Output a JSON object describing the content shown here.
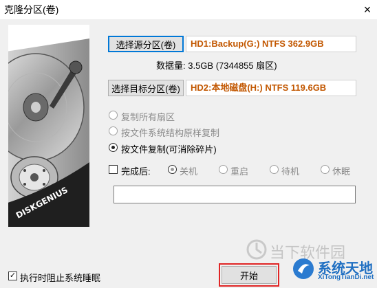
{
  "window": {
    "title": "克隆分区(卷)",
    "close_glyph": "×"
  },
  "disk_image": {
    "brand_text": "DISKGENIUS"
  },
  "source": {
    "button_label": "选择源分区(卷)",
    "value": "HD1:Backup(G:) NTFS 362.9GB"
  },
  "data_amount": {
    "text": "数据量: 3.5GB (7344855 扇区)"
  },
  "target": {
    "button_label": "选择目标分区(卷)",
    "value": "HD2:本地磁盘(H:) NTFS 119.6GB"
  },
  "copy_modes": [
    {
      "label": "复制所有扇区",
      "checked": false,
      "enabled": false
    },
    {
      "label": "按文件系统结构原样复制",
      "checked": false,
      "enabled": false
    },
    {
      "label": "按文件复制(可消除碎片)",
      "checked": true,
      "enabled": true
    }
  ],
  "after_complete": {
    "label": "完成后:",
    "checked": false,
    "options": [
      {
        "label": "关机",
        "checked": true
      },
      {
        "label": "重启",
        "checked": false
      },
      {
        "label": "待机",
        "checked": false
      },
      {
        "label": "休眠",
        "checked": false
      }
    ]
  },
  "command_input": {
    "value": ""
  },
  "prevent_sleep": {
    "label": "执行时阻止系统睡眠",
    "checked": true,
    "check_glyph": "✓"
  },
  "start_button": {
    "label": "开始"
  },
  "watermarks": {
    "left_text": "当下软件园",
    "right_title": "系统天地",
    "right_url": "XiTongTianDi.net"
  },
  "colors": {
    "value_text": "#c25700",
    "highlight": "#e02424",
    "focus_border": "#0078d7"
  }
}
